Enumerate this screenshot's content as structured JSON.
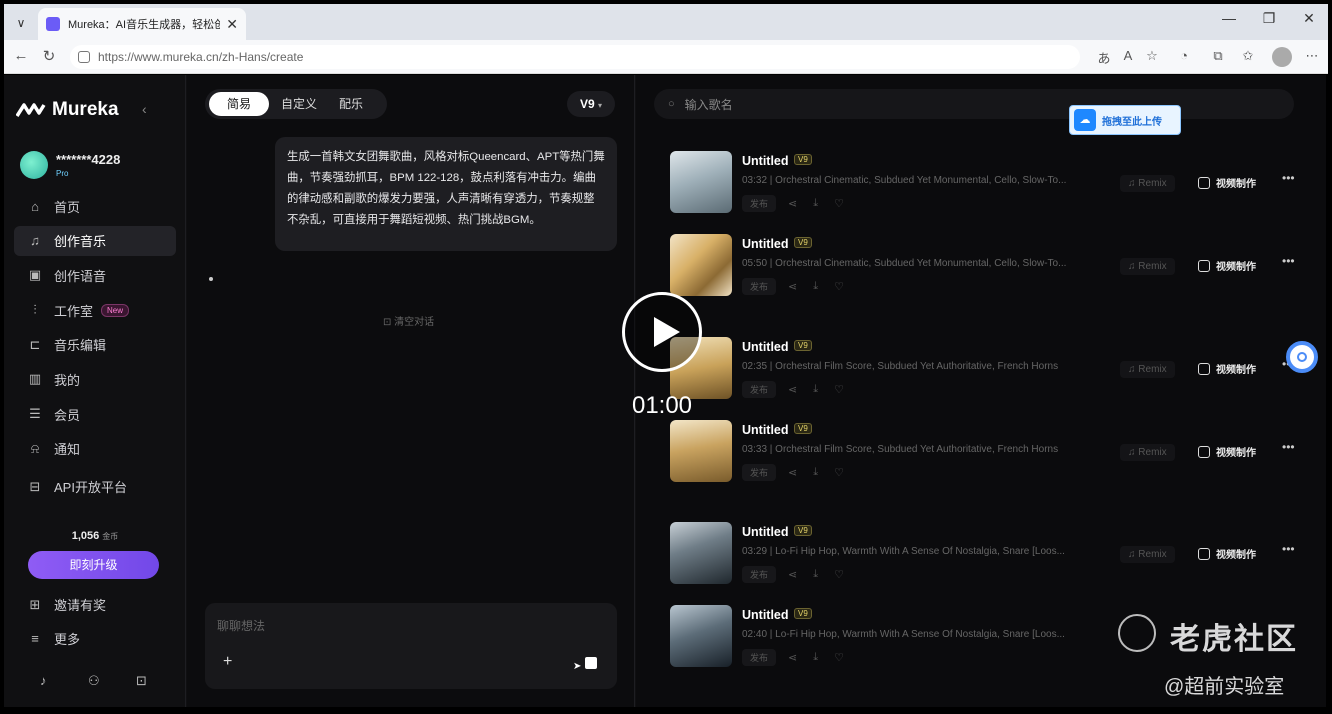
{
  "browser": {
    "tab_title": "Mureka：AI音乐生成器，轻松创作",
    "url": "https://www.mureka.cn/zh-Hans/create"
  },
  "sidebar": {
    "brand": "Mureka",
    "user_name": "*******4228",
    "user_plan": "Pro",
    "items": [
      {
        "label": "首页",
        "icon": "home-icon"
      },
      {
        "label": "创作音乐",
        "icon": "music-note-icon",
        "active": true
      },
      {
        "label": "创作语音",
        "icon": "voice-icon"
      },
      {
        "label": "工作室",
        "icon": "studio-icon",
        "badge": "New"
      },
      {
        "label": "音乐编辑",
        "icon": "edit-music-icon"
      },
      {
        "label": "我的",
        "icon": "library-icon"
      },
      {
        "label": "会员",
        "icon": "membership-icon"
      },
      {
        "label": "通知",
        "icon": "bell-icon"
      },
      {
        "label": "API开放平台",
        "icon": "api-icon"
      }
    ],
    "credits": "1,056",
    "credits_unit": "金币",
    "upgrade_label": "即刻升级",
    "invite_label": "邀请有奖",
    "more_label": "更多"
  },
  "chat": {
    "tabs": [
      "简易",
      "自定义",
      "配乐"
    ],
    "active_tab": "简易",
    "version": "V9",
    "message": "生成一首韩文女团舞歌曲，风格对标Queencard、APT等热门舞曲，节奏强劲抓耳，BPM 122-128，鼓点利落有冲击力。编曲的律动感和副歌的爆发力要强，人声清晰有穿透力，节奏规整不杂乱，可直接用于舞蹈短视频、热门挑战BGM。",
    "clear_label": "清空对话",
    "input_placeholder": "聊聊想法"
  },
  "songs": {
    "search_placeholder": "输入歌名",
    "upload_badge": "拖拽至此上传",
    "publish_label": "发布",
    "remix_label": "Remix",
    "video_label": "视频制作",
    "items": [
      {
        "title": "Untitled",
        "version": "V9",
        "meta": "03:32 | Orchestral Cinematic, Subdued Yet Monumental, Cello, Slow-To..."
      },
      {
        "title": "Untitled",
        "version": "V9",
        "meta": "05:50 | Orchestral Cinematic, Subdued Yet Monumental, Cello, Slow-To..."
      },
      {
        "title": "Untitled",
        "version": "V9",
        "meta": "02:35 | Orchestral Film Score, Subdued Yet Authoritative, French Horns"
      },
      {
        "title": "Untitled",
        "version": "V9",
        "meta": "03:33 | Orchestral Film Score, Subdued Yet Authoritative, French Horns"
      },
      {
        "title": "Untitled",
        "version": "V9",
        "meta": "03:29 | Lo-Fi Hip Hop, Warmth With A Sense Of Nostalgia, Snare [Loos..."
      },
      {
        "title": "Untitled",
        "version": "V9",
        "meta": "02:40 | Lo-Fi Hip Hop, Warmth With A Sense Of Nostalgia, Snare [Loos..."
      }
    ]
  },
  "player": {
    "time": "01:00"
  },
  "watermark": {
    "title": "老虎社区",
    "subtitle": "@超前实验室"
  }
}
